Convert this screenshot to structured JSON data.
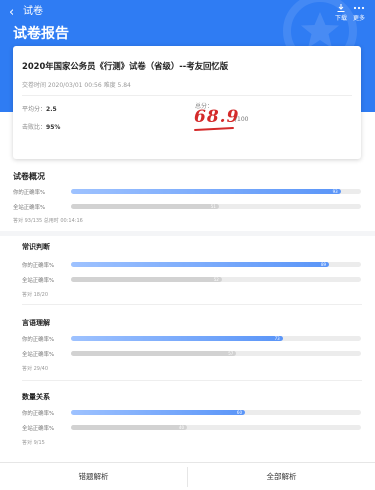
{
  "nav": {
    "back_glyph": "‹",
    "title": "试卷",
    "download_label": "下载",
    "more_label": "更多"
  },
  "page_title": "试卷报告",
  "card": {
    "exam_name": "2020年国家公务员《行测》试卷（省级）--考友回忆版",
    "meta": "交卷时间 2020/03/01 00:56  难度 5.84",
    "avg_label": "平均分：",
    "avg_value": "2.5",
    "beat_label": "击败比：",
    "beat_value": "95%",
    "score_label": "总分：",
    "score_value": "68.9",
    "score_total": "/100"
  },
  "overview": {
    "title": "试卷概况",
    "your_label": "你的正确率%",
    "all_label": "全站正确率%",
    "your_pct": 93,
    "all_pct": 51,
    "answered": "答对 93/135  总用时 00:14:16"
  },
  "sections": [
    {
      "name": "常识判断",
      "your_label": "你的正确率%",
      "all_label": "全站正确率%",
      "your_pct": 89,
      "all_pct": 52,
      "answered": "答对 18/20"
    },
    {
      "name": "言语理解",
      "your_label": "你的正确率%",
      "all_label": "全站正确率%",
      "your_pct": 73,
      "all_pct": 57,
      "answered": "答对 29/40"
    },
    {
      "name": "数量关系",
      "your_label": "你的正确率%",
      "all_label": "全站正确率%",
      "your_pct": 60,
      "all_pct": 40,
      "answered": "答对 9/15"
    }
  ],
  "bottom": {
    "wrong_label": "错题解析",
    "all_label": "全部解析"
  },
  "colors": {
    "header_blue": "#2f7cf3",
    "score_red": "#d42a2a",
    "bar_blue": "#5a95f8",
    "bar_gray": "#d2d2d2"
  }
}
